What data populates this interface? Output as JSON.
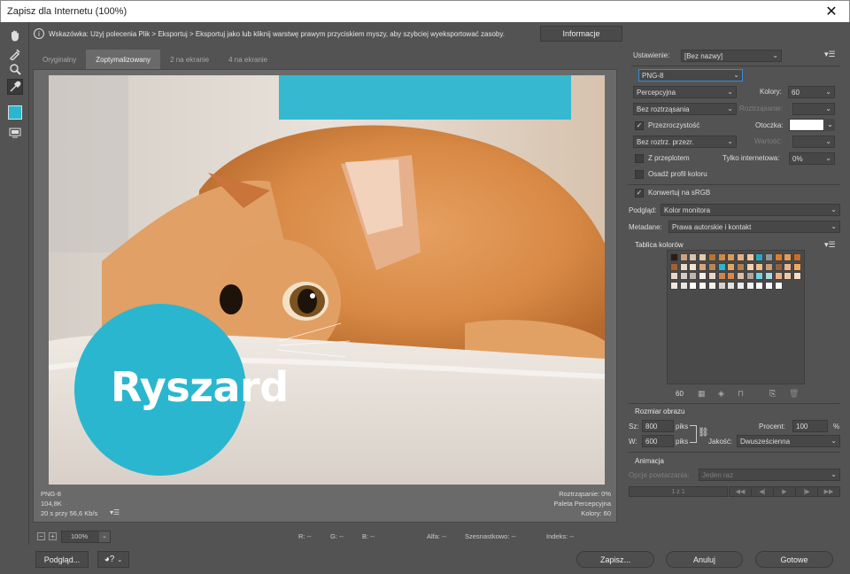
{
  "window": {
    "title": "Zapisz dla Internetu (100%)",
    "close": "✕"
  },
  "hint": {
    "text": "Wskazówka: Użyj polecenia Plik > Eksportuj > Eksportuj jako lub kliknij warstwę prawym przyciskiem myszy, aby szybciej wyeksportować zasoby.",
    "info_button": "Informacje"
  },
  "tabs": [
    "Oryginalny",
    "Zoptymalizowany",
    "2 na ekranie",
    "4 na ekranie"
  ],
  "image": {
    "overlay_text": "Ryszard",
    "circle_color": "#2bb6cf"
  },
  "status_left": {
    "format": "PNG-8",
    "size": "104,8K",
    "time": "20 s przy 56,6 Kb/s"
  },
  "status_right": {
    "dither": "Roztrząsanie: 0%",
    "palette": "Paleta Percepcyjna",
    "colors": "Kolory: 60"
  },
  "zoombar": {
    "zoom": "100%",
    "r": "R: --",
    "g": "G: --",
    "b": "B: --",
    "alpha": "Alfa: --",
    "hex": "Szesnastkowo: --",
    "index": "Indeks: --"
  },
  "settings": {
    "preset_label": "Ustawienie:",
    "preset_value": "[Bez nazwy]",
    "format": "PNG-8",
    "reduction": "Percepcyjna",
    "colors_label": "Kolory:",
    "colors_value": "60",
    "dither_algo": "Bez roztrząsania",
    "dither_label": "Roztrząsanie:",
    "transparency_label": "Przezroczystość",
    "transparency_checked": true,
    "matte_label": "Otoczka:",
    "matte_color": "#ffffff",
    "trans_dither": "Bez roztrz. przezr.",
    "amount_label": "Wartość:",
    "interlaced_label": "Z przeplotem",
    "web_snap_label": "Tylko internetowa:",
    "web_snap_value": "0%",
    "embed_profile_label": "Osadź profil koloru",
    "convert_srgb_label": "Konwertuj na sRGB",
    "preview_label": "Podgląd:",
    "preview_value": "Kolor monitora",
    "metadata_label": "Metadane:",
    "metadata_value": "Prawa autorskie i kontakt"
  },
  "color_table": {
    "title": "Tablica kolorów",
    "count": "60",
    "swatches": [
      "#2b1d14",
      "#c9a182",
      "#d9c3ad",
      "#e8c9a9",
      "#b8742f",
      "#cf8a46",
      "#d99a5a",
      "#e4b281",
      "#f0c79b",
      "#27a8c1",
      "#8f959c",
      "#d97f2b",
      "#e39a57",
      "#c96d26",
      "#a5612c",
      "#e8dccf",
      "#f2e4d3",
      "#d8a67a",
      "#ba8558",
      "#2fb5cf",
      "#e4a569",
      "#b37d53",
      "#f1d2b3",
      "#ecbf8b",
      "#c99b77",
      "#8f6142",
      "#e5b68e",
      "#f0a75b",
      "#e8d7c8",
      "#d5ccc3",
      "#bfb5ab",
      "#f6ede5",
      "#ead8c4",
      "#c8874c",
      "#d48b4e",
      "#dbbfa3",
      "#b3a598",
      "#73d3e3",
      "#a8dbe4",
      "#e9b283",
      "#f4c89e",
      "#f7dbbd",
      "#efe6df",
      "#e5e5e5",
      "#ffffff",
      "#fbf7f2",
      "#f5f0ea",
      "#d9d2cb",
      "#dfe2e3",
      "#ecebea",
      "#f3f3f3",
      "#ffffff",
      "#faf8f6",
      "#fffcf8"
    ]
  },
  "image_size": {
    "title": "Rozmiar obrazu",
    "w_label": "Sz:",
    "w_value": "800",
    "h_label": "W:",
    "h_value": "600",
    "unit": "piks",
    "percent_label": "Procent:",
    "percent_value": "100",
    "percent_unit": "%",
    "quality_label": "Jakość:",
    "quality_value": "Dwusześcienna"
  },
  "animation": {
    "title": "Animacja",
    "loop_label": "Opcje powtarzania:",
    "loop_value": "Jeden raz",
    "frame": "1 z 1"
  },
  "bottom": {
    "preview": "Podgląd...",
    "save": "Zapisz...",
    "cancel": "Anuluj",
    "done": "Gotowe"
  }
}
